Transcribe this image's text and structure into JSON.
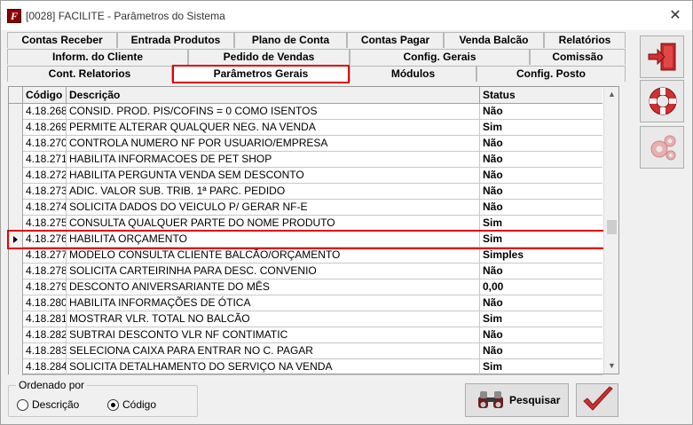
{
  "window": {
    "title": "[0028] FACILITE - Parâmetros do Sistema",
    "close_glyph": "✕"
  },
  "tabs": [
    {
      "label": "Contas Receber"
    },
    {
      "label": "Entrada Produtos"
    },
    {
      "label": "Plano de Conta"
    },
    {
      "label": "Contas Pagar"
    },
    {
      "label": "Venda Balcão"
    },
    {
      "label": "Relatórios"
    },
    {
      "label": "Inform. do Cliente"
    },
    {
      "label": "Pedido de Vendas"
    },
    {
      "label": "Config. Gerais"
    },
    {
      "label": "Comissão"
    },
    {
      "label": "Cont. Relatorios"
    },
    {
      "label": "Parâmetros Gerais",
      "active": true
    },
    {
      "label": "Módulos"
    },
    {
      "label": "Config. Posto"
    }
  ],
  "grid": {
    "columns": [
      "Código",
      "Descrição",
      "Status"
    ],
    "rows": [
      {
        "codigo": "4.18.268",
        "descricao": "CONSID. PROD. PIS/COFINS = 0 COMO ISENTOS",
        "status": "Não"
      },
      {
        "codigo": "4.18.269",
        "descricao": "PERMITE ALTERAR QUALQUER NEG. NA VENDA",
        "status": "Sim"
      },
      {
        "codigo": "4.18.270",
        "descricao": "CONTROLA NUMERO NF POR USUARIO/EMPRESA",
        "status": "Não"
      },
      {
        "codigo": "4.18.271",
        "descricao": "HABILITA INFORMACOES DE PET SHOP",
        "status": "Não"
      },
      {
        "codigo": "4.18.272",
        "descricao": "HABILITA PERGUNTA VENDA SEM DESCONTO",
        "status": "Não"
      },
      {
        "codigo": "4.18.273",
        "descricao": "ADIC. VALOR SUB. TRIB. 1ª PARC. PEDIDO",
        "status": "Não"
      },
      {
        "codigo": "4.18.274",
        "descricao": "SOLICITA DADOS DO VEICULO P/ GERAR NF-E",
        "status": "Não"
      },
      {
        "codigo": "4.18.275",
        "descricao": "CONSULTA QUALQUER PARTE DO NOME PRODUTO",
        "status": "Sim"
      },
      {
        "codigo": "4.18.276",
        "descricao": "HABILITA ORÇAMENTO",
        "status": "Sim",
        "selected": true
      },
      {
        "codigo": "4.18.277",
        "descricao": "MODELO CONSULTA CLIENTE BALCÃO/ORÇAMENTO",
        "status": "Simples"
      },
      {
        "codigo": "4.18.278",
        "descricao": "SOLICITA CARTEIRINHA PARA DESC. CONVENIO",
        "status": "Não"
      },
      {
        "codigo": "4.18.279",
        "descricao": "DESCONTO ANIVERSARIANTE DO MÊS",
        "status": "0,00"
      },
      {
        "codigo": "4.18.280",
        "descricao": "HABILITA INFORMAÇÕES DE ÓTICA",
        "status": "Não"
      },
      {
        "codigo": "4.18.281",
        "descricao": "MOSTRAR VLR. TOTAL NO BALCÃO",
        "status": "Sim"
      },
      {
        "codigo": "4.18.282",
        "descricao": "SUBTRAI DESCONTO VLR NF CONTIMATIC",
        "status": "Não"
      },
      {
        "codigo": "4.18.283",
        "descricao": "SELECIONA CAIXA PARA ENTRAR NO C. PAGAR",
        "status": "Não"
      },
      {
        "codigo": "4.18.284",
        "descricao": "SOLICITA DETALHAMENTO DO SERVIÇO NA VENDA",
        "status": "Sim"
      }
    ]
  },
  "ordering": {
    "legend": "Ordenado por",
    "options": [
      "Descrição",
      "Código"
    ],
    "selected": "Código"
  },
  "buttons": {
    "search_label": "Pesquisar",
    "exit_icon": "exit-door-icon",
    "help_icon": "lifebuoy-icon",
    "settings_icon": "gears-icon",
    "confirm_icon": "checkmark-icon"
  },
  "colors": {
    "highlight": "#e00000",
    "confirm": "#c83030"
  }
}
